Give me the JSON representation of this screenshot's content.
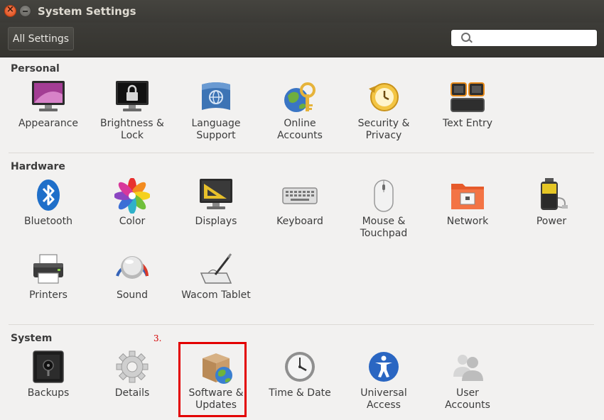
{
  "window": {
    "title": "System Settings"
  },
  "toolbar": {
    "all_settings_label": "All Settings",
    "search_placeholder": "",
    "search_value": ""
  },
  "sections": {
    "personal": {
      "title": "Personal",
      "items": [
        {
          "label1": "Appearance",
          "label2": "",
          "icon": "appearance-icon"
        },
        {
          "label1": "Brightness &",
          "label2": "Lock",
          "icon": "lock-icon"
        },
        {
          "label1": "Language",
          "label2": "Support",
          "icon": "language-flag-icon"
        },
        {
          "label1": "Online",
          "label2": "Accounts",
          "icon": "online-accounts-icon"
        },
        {
          "label1": "Security &",
          "label2": "Privacy",
          "icon": "security-clock-icon"
        },
        {
          "label1": "Text Entry",
          "label2": "",
          "icon": "keyboard-keys-icon"
        }
      ]
    },
    "hardware": {
      "title": "Hardware",
      "items": [
        {
          "label1": "Bluetooth",
          "label2": "",
          "icon": "bluetooth-icon"
        },
        {
          "label1": "Color",
          "label2": "",
          "icon": "color-flower-icon"
        },
        {
          "label1": "Displays",
          "label2": "",
          "icon": "display-icon"
        },
        {
          "label1": "Keyboard",
          "label2": "",
          "icon": "keyboard-icon"
        },
        {
          "label1": "Mouse &",
          "label2": "Touchpad",
          "icon": "mouse-icon"
        },
        {
          "label1": "Network",
          "label2": "",
          "icon": "network-folder-icon"
        },
        {
          "label1": "Power",
          "label2": "",
          "icon": "battery-icon"
        },
        {
          "label1": "Printers",
          "label2": "",
          "icon": "printer-icon"
        },
        {
          "label1": "Sound",
          "label2": "",
          "icon": "speaker-knob-icon"
        },
        {
          "label1": "Wacom Tablet",
          "label2": "",
          "icon": "tablet-pen-icon"
        }
      ]
    },
    "system": {
      "title": "System",
      "items": [
        {
          "label1": "Backups",
          "label2": "",
          "icon": "safe-icon"
        },
        {
          "label1": "Details",
          "label2": "",
          "icon": "gear-icon"
        },
        {
          "label1": "Software &",
          "label2": "Updates",
          "icon": "software-box-globe-icon"
        },
        {
          "label1": "Time & Date",
          "label2": "",
          "icon": "clock-icon"
        },
        {
          "label1": "Universal",
          "label2": "Access",
          "icon": "accessibility-icon"
        },
        {
          "label1": "User",
          "label2": "Accounts",
          "icon": "users-icon"
        }
      ]
    }
  },
  "annotation": {
    "step_label": "3."
  },
  "colors": {
    "titlebar": "#3b3a36",
    "accent_close": "#dd4814",
    "highlight": "#e30000",
    "background": "#f2f1f0"
  }
}
